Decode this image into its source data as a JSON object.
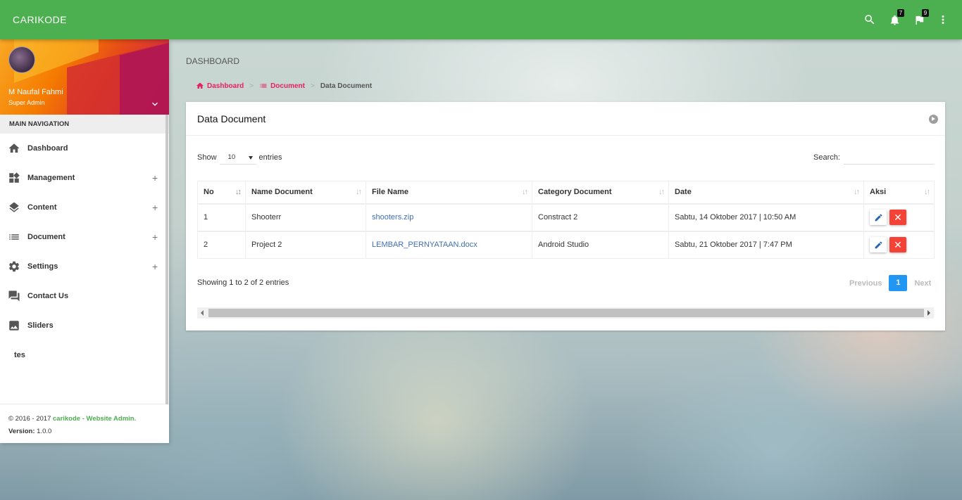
{
  "topbar": {
    "brand": "CARIKODE",
    "icons": [
      "search-icon",
      "bell-icon",
      "flag-icon",
      "more-vert-icon"
    ],
    "notifications_count": "7",
    "tasks_count": "9",
    "color": "#4caf50"
  },
  "user": {
    "name": "M Naufal Fahmi",
    "role": "Super Admin"
  },
  "sidebar": {
    "header": "MAIN NAVIGATION",
    "items": [
      {
        "label": "Dashboard",
        "icon": "home-icon",
        "expandable": false
      },
      {
        "label": "Management",
        "icon": "widgets-icon",
        "expandable": true
      },
      {
        "label": "Content",
        "icon": "layers-icon",
        "expandable": true
      },
      {
        "label": "Document",
        "icon": "list-icon",
        "expandable": true
      },
      {
        "label": "Settings",
        "icon": "gear-icon",
        "expandable": true
      },
      {
        "label": "Contact Us",
        "icon": "forum-icon",
        "expandable": false
      },
      {
        "label": "Sliders",
        "icon": "image-icon",
        "expandable": false
      },
      {
        "label": "tes",
        "icon": "",
        "expandable": false
      }
    ],
    "plus": "+"
  },
  "footer": {
    "copyright": "© 2016 - 2017",
    "brand_link": "carikode - Website Admin.",
    "version_label": "Version:",
    "version": "1.0.0"
  },
  "page": {
    "title": "DASHBOARD",
    "breadcrumb": [
      "Dashboard",
      "Document",
      "Data Document"
    ],
    "separator": ">"
  },
  "card": {
    "title": "Data Document",
    "show_label": "Show",
    "entries_value": "10",
    "entries_label": "entries",
    "search_label": "Search:",
    "search_value": "",
    "columns": [
      "No",
      "Name Document",
      "File Name",
      "Category Document",
      "Date",
      "Aksi"
    ],
    "rows": [
      {
        "no": "1",
        "name": "Shooterr",
        "file": "shooters.zip",
        "category": "Constract 2",
        "date": "Sabtu, 14 Oktober 2017 | 10:50 AM"
      },
      {
        "no": "2",
        "name": "Project 2",
        "file": "LEMBAR_PERNYATAAN.docx",
        "category": "Android Studio",
        "date": "Sabtu, 21 Oktober 2017 | 7:47 PM"
      }
    ],
    "delete_glyph": "✕",
    "info": "Showing 1 to 2 of 2 entries",
    "pagination": {
      "previous": "Previous",
      "current": "1",
      "next": "Next"
    },
    "accent": "#e91e63",
    "page_active_color": "#2196f3",
    "delete_color": "#f44336"
  }
}
